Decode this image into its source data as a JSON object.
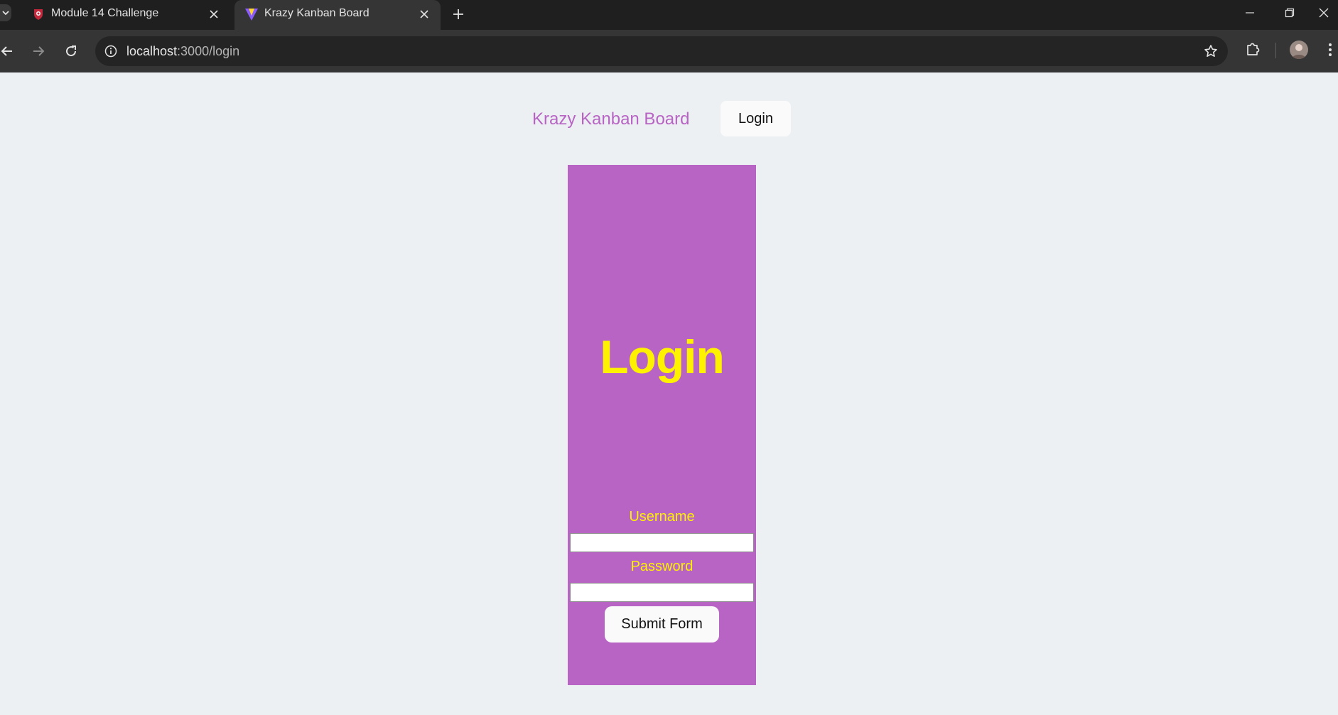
{
  "browser": {
    "tabs": [
      {
        "title": "Module 14 Challenge",
        "favicon": "shield-favicon-icon",
        "active": false
      },
      {
        "title": "Krazy Kanban Board",
        "favicon": "vite-favicon-icon",
        "active": true
      }
    ],
    "url_host": "localhost",
    "url_path": ":3000/login",
    "icons": {
      "tab_list": "chevron-down-icon",
      "new_tab": "plus-icon",
      "back": "back-arrow-icon",
      "forward": "forward-arrow-icon",
      "reload": "reload-icon",
      "site_info": "info-icon",
      "bookmark": "star-icon",
      "extensions": "puzzle-icon",
      "profile": "avatar",
      "menu": "kebab-menu-icon",
      "minimize": "minimize-icon",
      "restore": "restore-icon",
      "close": "close-icon"
    }
  },
  "navbar": {
    "site_title": "Krazy Kanban Board",
    "login_button": "Login"
  },
  "login_form": {
    "heading": "Login",
    "username_label": "Username",
    "username_value": "",
    "password_label": "Password",
    "password_value": "",
    "submit_label": "Submit Form"
  },
  "colors": {
    "page_background": "#edf0f2",
    "card_background": "#b764c4",
    "heading_color": "#fff200",
    "site_title_color": "#b764c4",
    "button_background": "#fafafa"
  }
}
